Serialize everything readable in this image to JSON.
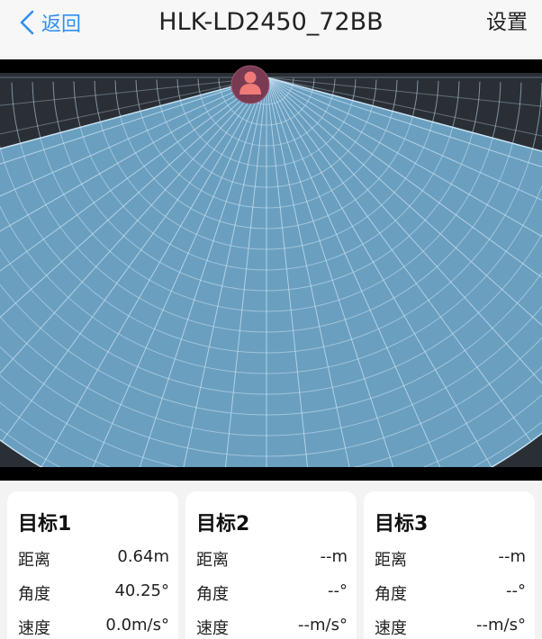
{
  "header": {
    "back_label": "返回",
    "title": "HLK-LD2450_72BB",
    "settings_label": "设置"
  },
  "radar": {
    "icons": {
      "back": "chevron-left-icon",
      "sensor": "person-icon"
    },
    "colors": {
      "fan": "#6a9fc0",
      "grid": "#c9e2f2",
      "background": "#2a2f36",
      "sensor_circle": "#7a3a52",
      "sensor_person": "#f07a78",
      "accent": "#2f8ff0"
    }
  },
  "targets": [
    {
      "title": "目标1",
      "distance_label": "距离",
      "distance_value": "0.64m",
      "angle_label": "角度",
      "angle_value": "40.25°",
      "speed_label": "速度",
      "speed_value": "0.0m/s°"
    },
    {
      "title": "目标2",
      "distance_label": "距离",
      "distance_value": "--m",
      "angle_label": "角度",
      "angle_value": "--°",
      "speed_label": "速度",
      "speed_value": "--m/s°"
    },
    {
      "title": "目标3",
      "distance_label": "距离",
      "distance_value": "--m",
      "angle_label": "角度",
      "angle_value": "--°",
      "speed_label": "速度",
      "speed_value": "--m/s°"
    }
  ]
}
